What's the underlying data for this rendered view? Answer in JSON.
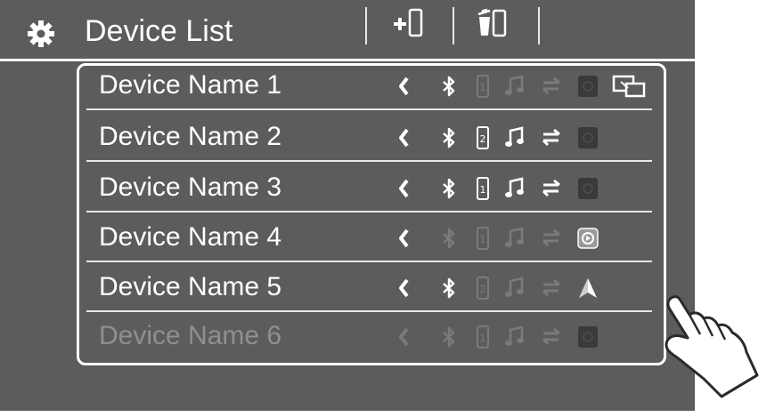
{
  "header": {
    "title": "Device List",
    "settings_icon": "gear-icon",
    "add_device_icon": "add-device-icon",
    "delete_device_icon": "delete-device-icon"
  },
  "devices": [
    {
      "name": "Device Name 1",
      "number": "1",
      "bluetooth_on": true,
      "phone_on": false,
      "audio_on": false,
      "transfer_on": false,
      "app_icon": "app-dark-icon",
      "extra_icon": "mirror-screen-icon",
      "active": true
    },
    {
      "name": "Device Name 2",
      "number": "2",
      "bluetooth_on": true,
      "phone_on": true,
      "audio_on": true,
      "transfer_on": true,
      "app_icon": "app-dark-icon",
      "extra_icon": "",
      "active": true
    },
    {
      "name": "Device Name 3",
      "number": "1",
      "bluetooth_on": true,
      "phone_on": true,
      "audio_on": true,
      "transfer_on": true,
      "app_icon": "app-dark-icon",
      "extra_icon": "",
      "active": true
    },
    {
      "name": "Device Name 4",
      "number": "1",
      "bluetooth_on": false,
      "phone_on": false,
      "audio_on": false,
      "transfer_on": false,
      "app_icon": "carplay-icon",
      "extra_icon": "",
      "active": true
    },
    {
      "name": "Device Name 5",
      "number": "2",
      "bluetooth_on": true,
      "phone_on": false,
      "audio_on": false,
      "transfer_on": false,
      "app_icon": "navigation-icon",
      "extra_icon": "",
      "active": true
    },
    {
      "name": "Device Name 6",
      "number": "1",
      "bluetooth_on": false,
      "phone_on": false,
      "audio_on": false,
      "transfer_on": false,
      "app_icon": "app-dark-icon",
      "extra_icon": "",
      "active": false
    }
  ],
  "hand_icon": "touch-hand-icon",
  "colors": {
    "panel": "#5c5c5c",
    "on": "#ffffff",
    "off": "#7a7a7a",
    "app_dark": "#3a3a3a"
  }
}
